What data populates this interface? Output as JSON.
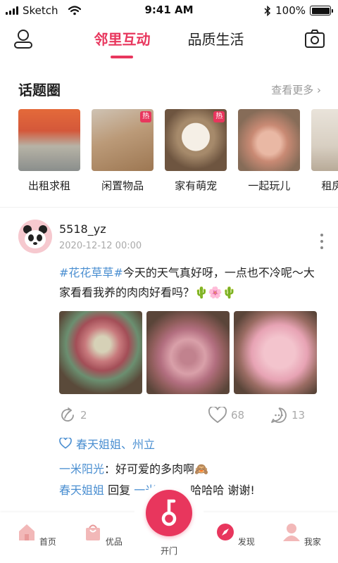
{
  "status_bar": {
    "carrier": "Sketch",
    "time": "9:41 AM",
    "battery": "100%",
    "battery_level": 1.0
  },
  "header": {
    "tabs": [
      {
        "label": "邻里互动",
        "active": true
      },
      {
        "label": "品质生活",
        "active": false
      }
    ]
  },
  "topics": {
    "title": "话题圈",
    "more": "查看更多 ›",
    "items": [
      {
        "label": "出租求租",
        "hot": false
      },
      {
        "label": "闲置物品",
        "hot": true,
        "hot_text": "热"
      },
      {
        "label": "家有萌宠",
        "hot": true,
        "hot_text": "热"
      },
      {
        "label": "一起玩儿",
        "hot": false
      },
      {
        "label": "租房停车",
        "hot": false
      }
    ]
  },
  "post": {
    "username": "5518_yz",
    "time": "2020-12-12 00:00",
    "hashtag": "#花花草草#",
    "text": "今天的天气真好呀，一点也不冷呢～大家看看我养的肉肉好看吗？🌵🌸🌵",
    "share_count": "2",
    "like_count": "68",
    "comment_count": "13",
    "liked_by": "春天姐姐、州立",
    "comments": [
      {
        "name": "一米阳光",
        "sep": "：",
        "text": "好可爱的多肉啊🙈"
      },
      {
        "name": "春天姐姐",
        "sep": " 回复 ",
        "reply_to": "一米阳光",
        "sep2": "：",
        "text": "哈哈哈 谢谢!"
      }
    ]
  },
  "bottom_nav": {
    "items": [
      {
        "label": "首页"
      },
      {
        "label": "优品"
      },
      {
        "label": "开门"
      },
      {
        "label": "发现"
      },
      {
        "label": "我家"
      }
    ]
  },
  "colors": {
    "accent": "#e8365d",
    "link": "#4b8fd1",
    "muted": "#aaaaaa"
  }
}
